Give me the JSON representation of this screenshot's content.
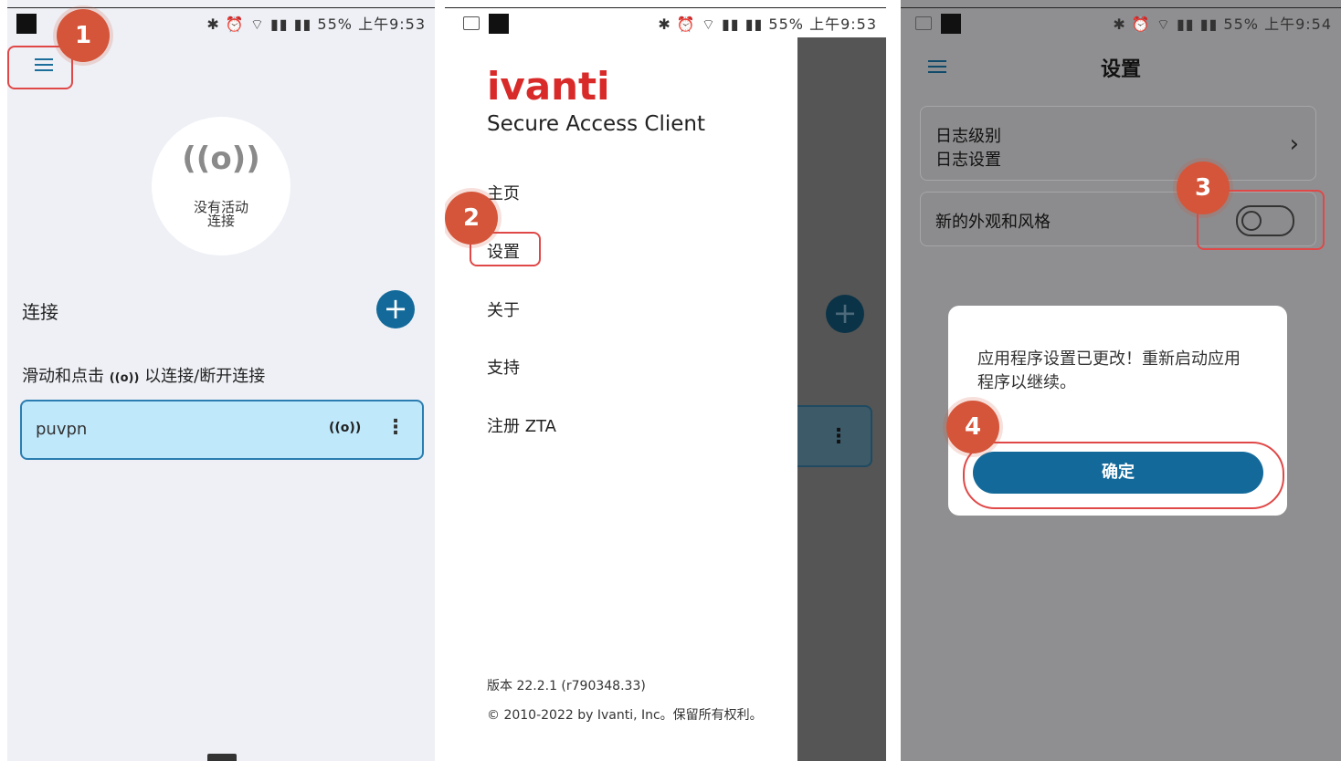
{
  "status_bars": [
    {
      "icons": "✱ ⏰ ⌔ ▮▮ ▮▮",
      "battery": "55%",
      "time": "上午9:53"
    },
    {
      "icons": "✱ ⏰ ⌔ ▮▮ ▮▮",
      "battery": "55%",
      "time": "上午9:53"
    },
    {
      "icons": "✱ ⏰ ⌔ ▮▮ ▮▮",
      "battery": "55%",
      "time": "上午9:54"
    }
  ],
  "steps": [
    "1",
    "2",
    "3",
    "4"
  ],
  "home": {
    "status_icon": "((o))",
    "status_line1": "没有活动",
    "status_line2": "连接",
    "section_title": "连接",
    "add_label": "+",
    "hint_prefix": "滑动和点击",
    "hint_icon": "((o))",
    "hint_suffix": "以连接/断开连接",
    "connection": {
      "name": "puvpn",
      "connect_icon": "((o))",
      "more": "⋮"
    }
  },
  "drawer": {
    "logo": "ivanti",
    "subtitle": "Secure Access Client",
    "items": [
      "主页",
      "设置",
      "关于",
      "支持",
      "注册 ZTA"
    ],
    "version": "版本 22.2.1 (r790348.33)",
    "copyright": "© 2010-2022 by Ivanti, Inc。保留所有权利。",
    "overlay_add": "+",
    "overlay_more": "⋮"
  },
  "settings": {
    "title": "设置",
    "log_level_title": "日志级别",
    "log_level_sub": "日志设置",
    "chevron": "›",
    "new_look_label": "新的外观和风格",
    "new_look_enabled": false
  },
  "dialog": {
    "message": "应用程序设置已更改！重新启动应用程序以继续。",
    "ok": "确定"
  },
  "colors": {
    "accent": "#136a9a",
    "callout": "#e04848",
    "badge": "#d4553a",
    "logo": "#d92a2a"
  }
}
